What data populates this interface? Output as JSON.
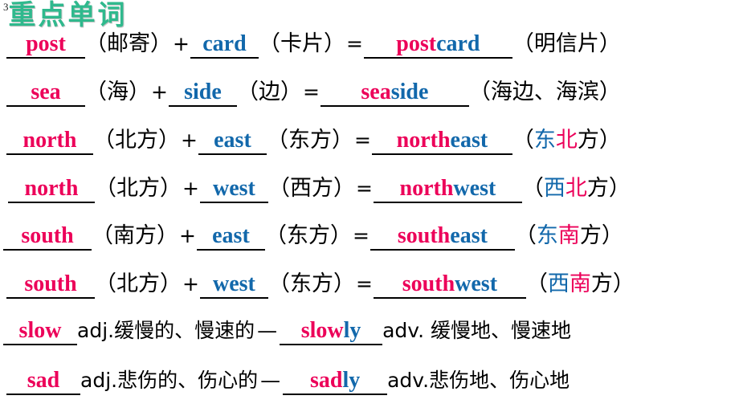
{
  "slide": {
    "number": "3",
    "title": "重点单词",
    "title_color": "#2fb98d",
    "accent_pink": "#ec0059",
    "accent_blue": "#1268ab"
  },
  "rows": [
    {
      "id": "postcard",
      "left_word": "post",
      "left_gloss": "（邮寄）",
      "plus": "+",
      "right_word": "card",
      "right_gloss": "（卡片）",
      "equals": "=",
      "answer_part1": "post",
      "answer_part2": "card",
      "answer_gloss": "（明信片）",
      "answer_gloss_plain": true
    },
    {
      "id": "seaside",
      "left_word": "sea",
      "left_gloss": "（海）",
      "plus": "+",
      "right_word": "side",
      "right_gloss": "（边）",
      "equals": "=",
      "answer_part1": "sea",
      "answer_part2": "side",
      "answer_gloss": "（海边、海滨）",
      "answer_gloss_plain": true
    },
    {
      "id": "northeast",
      "left_word": "north",
      "left_gloss": "（北方）",
      "plus": "+",
      "right_word": "east",
      "right_gloss": "（东方）",
      "equals": "=",
      "answer_part1": "north",
      "answer_part2": "east",
      "answer_gloss_open": "（",
      "answer_gloss_blue": "东",
      "answer_gloss_pink": "北",
      "answer_gloss_black": "方",
      "answer_gloss_close": "）",
      "answer_gloss_plain": false
    },
    {
      "id": "northwest",
      "left_word": "north",
      "left_gloss": "（北方）",
      "plus": "+",
      "right_word": "west",
      "right_gloss": "（西方）",
      "equals": "=",
      "answer_part1": "north",
      "answer_part2": "west",
      "answer_gloss_open": "（",
      "answer_gloss_blue": "西",
      "answer_gloss_pink": "北",
      "answer_gloss_black": "方",
      "answer_gloss_close": "）",
      "answer_gloss_plain": false
    },
    {
      "id": "southeast",
      "left_word": "south",
      "left_gloss": "（南方）",
      "plus": "+",
      "right_word": "east",
      "right_gloss": "（东方）",
      "equals": "=",
      "answer_part1": "south",
      "answer_part2": "east",
      "answer_gloss_open": "（",
      "answer_gloss_blue": "东",
      "answer_gloss_pink": "南",
      "answer_gloss_black": "方",
      "answer_gloss_close": "）",
      "answer_gloss_plain": false
    },
    {
      "id": "southwest",
      "left_word": "south",
      "left_gloss": "（北方）",
      "plus": "+",
      "right_word": "west",
      "right_gloss": "（东方）",
      "equals": "=",
      "answer_part1": "south",
      "answer_part2": "west",
      "answer_gloss_open": "（",
      "answer_gloss_blue": "西",
      "answer_gloss_pink": "南",
      "answer_gloss_black": "方",
      "answer_gloss_close": "）",
      "answer_gloss_plain": false
    }
  ],
  "adv_rows": [
    {
      "id": "slow-slowly",
      "adj_word": "slow",
      "adj_pos": "adj.缓慢的、慢速的",
      "dash": "—",
      "adv_part1": "slow",
      "adv_part2": "ly",
      "adv_pos": "adv. 缓慢地、慢速地"
    },
    {
      "id": "sad-sadly",
      "adj_word": "sad",
      "adj_pos": "adj.悲伤的、伤心的",
      "dash": "—",
      "adv_part1": "sad",
      "adv_part2": "ly",
      "adv_pos": "adv.悲伤地、伤心地"
    }
  ]
}
